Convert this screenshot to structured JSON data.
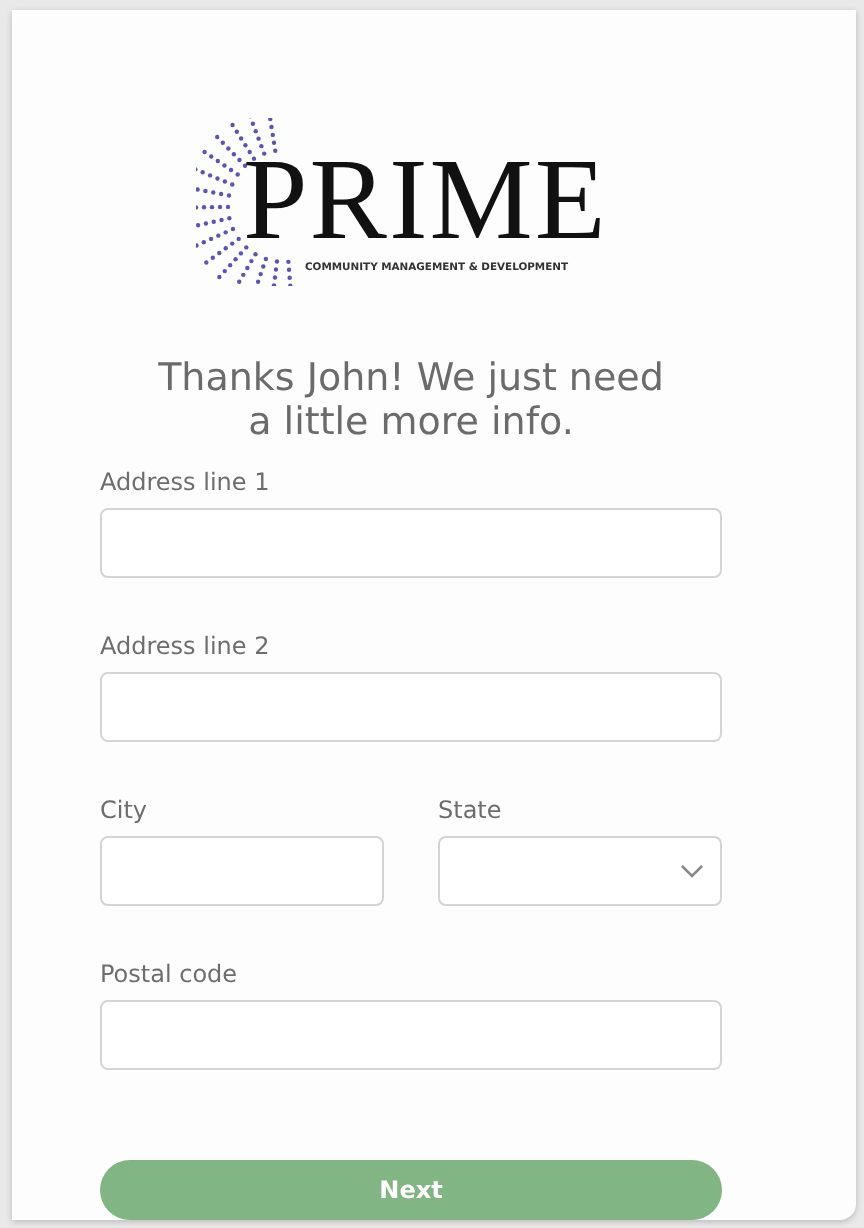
{
  "logo": {
    "name": "PRIME",
    "tagline": "COMMUNITY MANAGEMENT & DEVELOPMENT"
  },
  "heading": "Thanks John! We just need a little more info.",
  "rows": [
    [
      {
        "label": "Address line 1",
        "kind": "text"
      }
    ],
    [
      {
        "label": "Address line 2",
        "kind": "text"
      }
    ],
    [
      {
        "label": "City",
        "kind": "text"
      },
      {
        "label": "State",
        "kind": "select"
      }
    ],
    [
      {
        "label": "Postal code",
        "kind": "text"
      }
    ]
  ],
  "button": "Next"
}
